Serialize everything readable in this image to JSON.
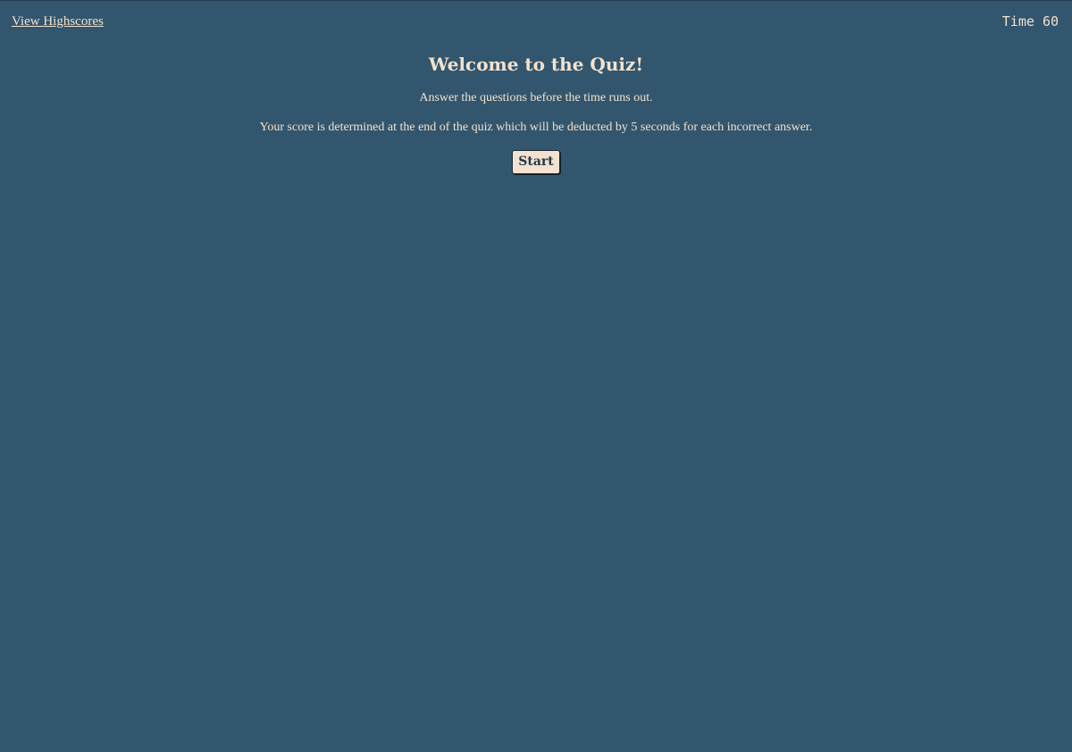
{
  "header": {
    "highscores_link": "View Highscores",
    "timer_label": "Time",
    "timer_value": "60"
  },
  "main": {
    "title": "Welcome to the Quiz!",
    "instructions": "Answer the questions before the time runs out.",
    "scoring": "Your score is determined at the end of the quiz which will be deducted by 5 seconds for each incorrect answer.",
    "start_label": "Start"
  },
  "colors": {
    "background": "#32566d",
    "text": "#f3e2cf",
    "button_background": "#f3e2cf",
    "button_text": "#22394a"
  }
}
